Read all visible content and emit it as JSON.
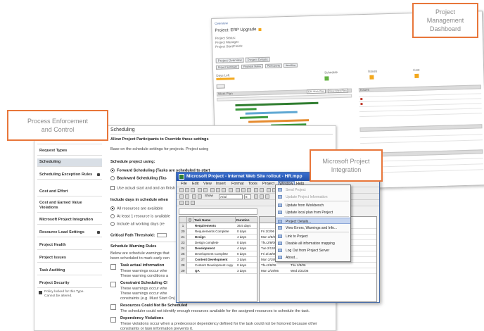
{
  "callouts": {
    "dashboard": "Project\nManagement\nDashboard",
    "process": "Process Enforcement\nand Control",
    "integration": "Microsoft Project\nIntegration"
  },
  "settings": {
    "nav": [
      {
        "label": "Work Plan Template",
        "lock": false,
        "active": false
      },
      {
        "label": "Request Types",
        "lock": false,
        "active": false
      },
      {
        "label": "Scheduling",
        "lock": false,
        "active": true
      },
      {
        "label": "Scheduling Exception Rules",
        "lock": true,
        "active": false
      },
      {
        "label": "Cost and Effort",
        "lock": false,
        "active": false
      },
      {
        "label": "Cost and Earned Value Violations",
        "lock": false,
        "active": false
      },
      {
        "label": "Microsoft Project Integration",
        "lock": false,
        "active": false
      },
      {
        "label": "Resource Load Settings",
        "lock": true,
        "active": false
      },
      {
        "label": "Project Health",
        "lock": false,
        "active": false
      },
      {
        "label": "Project Issues",
        "lock": false,
        "active": false
      },
      {
        "label": "Task Auditing",
        "lock": false,
        "active": false
      },
      {
        "label": "Project Security",
        "lock": false,
        "active": false
      }
    ],
    "nav_note": "Policy locked for this Type. Cannot be altered.",
    "title": "Scheduling",
    "allow_override": "Allow Project Participants to Override these settings",
    "based_on": "Base on the schedule settings for projects. Project using",
    "schedule_project_using": "Schedule project using:",
    "forward": "Forward Scheduling (Tasks are scheduled to start",
    "backward": "Backward Scheduling (Tas",
    "use_actual": "Use actual start and and an finish",
    "include_days": "Include days in schedule when",
    "all_resources": "All resources are available",
    "atleast_one": "At least 1 resource is available",
    "include_all": "Include all working days (re",
    "critical_path": "Critical Path Threshold:",
    "warning_rules": "Schedule Warning Rules",
    "warning_desc1": "Below are schedule warnings that",
    "warning_desc2": "been scheduled to mark early cen",
    "task_actual": "Task actual information",
    "task_actual_d1": "These warnings occur whe",
    "task_actual_d2": "These warning conditions a",
    "constraint": "Constraint Scheduling Cl",
    "constraint_d1": "These warnings occur whe",
    "constraint_d2": "These warnings occur whe",
    "constraint_d3": "constraints (e.g. Must Start On) do not leave enough time to achieve the desired schedule.",
    "resources_heading": "Resources Could Not Be Scheduled",
    "resources_desc": "The scheduler could not identify enough resources available for the assigned resources to schedule the task.",
    "dependency_heading": "Dependency Violations",
    "dependency_desc1": "These violations occur when a predecessor dependency defined for the task could not be honored because other",
    "dependency_desc2": "constraints or task information prevents it."
  },
  "dashboard": {
    "breadcrumb": "Overview",
    "project_name": "Project: ERP Upgrade",
    "fields": [
      "Project Status:",
      "Project Manager:",
      "Project Start/Finish:"
    ],
    "tabs": [
      "Project Overview",
      "Project Details"
    ],
    "subtabs": [
      "Project Summary",
      "Financial Status",
      "Participants",
      "Workflow"
    ],
    "health_labels": [
      "Schedule",
      "Issues",
      "Cost"
    ],
    "gantt_title": "Work Plan",
    "gantt_buttons": [
      "Edit Work Plan",
      "View Work Plan"
    ],
    "issues_title": "Issues",
    "days_left": "Days Left"
  },
  "msp": {
    "title": "Microsoft Project - Internet Web Site rollout - HR.mpp",
    "menus": [
      "File",
      "Edit",
      "View",
      "Insert",
      "Format",
      "Tools",
      "Project",
      "Window",
      "Help"
    ],
    "open_menu": "Window",
    "font_field": "Arial",
    "zoom_field": "8",
    "show_label": "Show",
    "grid_headers": [
      "",
      "Task Name",
      "Duration"
    ],
    "rows": [
      {
        "id": "1",
        "name": "Requirements",
        "bold": true,
        "duration": "36.5 days"
      },
      {
        "id": "20",
        "name": "Requirements Complete",
        "bold": false,
        "duration": "0 days"
      },
      {
        "id": "21",
        "name": "Design",
        "bold": true,
        "duration": "4 days"
      },
      {
        "id": "23",
        "name": "Design complete",
        "bold": false,
        "duration": "0 days"
      },
      {
        "id": "24",
        "name": "Development",
        "bold": true,
        "duration": "4 days"
      },
      {
        "id": "26",
        "name": "Development Complete",
        "bold": false,
        "duration": "0 days"
      },
      {
        "id": "27",
        "name": "Content Development",
        "bold": true,
        "duration": "3 days"
      },
      {
        "id": "28",
        "name": "Content Development copy",
        "bold": false,
        "duration": "0 days"
      },
      {
        "id": "29",
        "name": "QA",
        "bold": true,
        "duration": "3 days"
      }
    ],
    "gantt_rows": [
      {
        "start": "",
        "finish": ""
      },
      {
        "start": "Fri 2/2/06",
        "finish": "Fri 2/2/06"
      },
      {
        "start": "Mon 2/5/06",
        "finish": "Thu 2/8/06"
      },
      {
        "start": "Thu 2/8/06",
        "finish": "Thu 2/8/06"
      },
      {
        "start": "Tue 2/13/06",
        "finish": "Fri 2/16/06"
      },
      {
        "start": "Fri 2/16/06",
        "finish": "Fri 2/16/06"
      },
      {
        "start": "Mon 2/19/06",
        "finish": "Wed 2/21/06"
      },
      {
        "start": "Thu 2/8/06",
        "finish": "Thu 2/8/06"
      },
      {
        "start": "Mon 2/19/06",
        "finish": "Wed 2/21/06"
      }
    ]
  },
  "dropdown": {
    "items": [
      {
        "label": "Send Project",
        "gray": true,
        "sel": false
      },
      {
        "label": "Update Project Information",
        "gray": true,
        "sel": false
      },
      {
        "label": "Update from Workbench",
        "gray": false,
        "sel": false
      },
      {
        "label": "Update local plan from Project",
        "gray": false,
        "sel": false
      },
      {
        "label": "Project Details...",
        "gray": false,
        "sel": true
      },
      {
        "label": "View Errors, Warnings and Info...",
        "gray": false,
        "sel": false
      },
      {
        "label": "Link to Project",
        "gray": false,
        "sel": false
      },
      {
        "label": "Disable all information mapping",
        "gray": false,
        "sel": false
      },
      {
        "label": "Log Out from Project Server",
        "gray": false,
        "sel": false
      },
      {
        "label": "About...",
        "gray": false,
        "sel": false
      }
    ]
  }
}
